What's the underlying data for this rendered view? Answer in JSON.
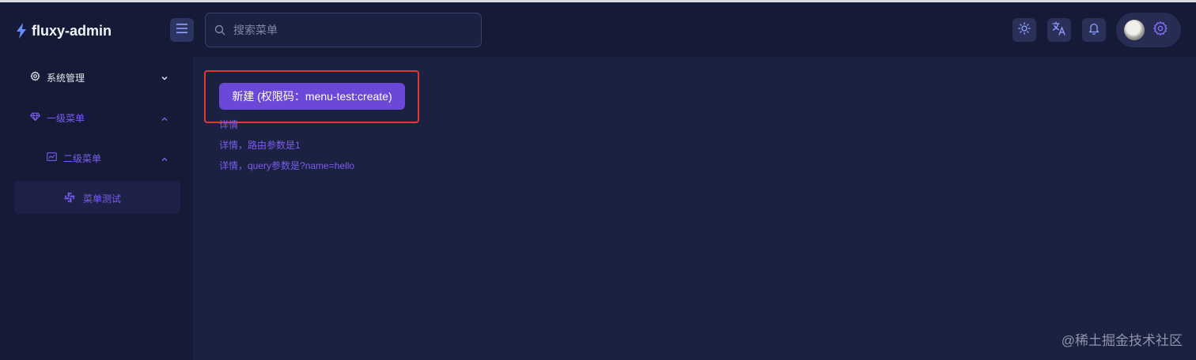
{
  "app": {
    "title": "fluxy-admin"
  },
  "colors": {
    "accent": "#6b48d7",
    "link": "#7b5cf0",
    "background": "#151b36",
    "content_background": "#1b2140",
    "highlight_border": "#e2392f"
  },
  "header": {
    "menu_toggle_icon": "menu-icon",
    "search": {
      "placeholder": "搜索菜单",
      "value": ""
    },
    "actions": [
      {
        "name": "theme-toggle-button",
        "icon": "sun-icon"
      },
      {
        "name": "language-button",
        "icon": "translate-icon"
      },
      {
        "name": "notifications-button",
        "icon": "bell-icon"
      }
    ],
    "settings_icon": "gear-icon"
  },
  "sidebar": {
    "items": [
      {
        "label": "系统管理",
        "icon": "gear-icon",
        "expanded": false
      },
      {
        "label": "一级菜单",
        "icon": "gem-icon",
        "expanded": true
      },
      {
        "label": "二级菜单",
        "icon": "chart-icon",
        "expanded": true
      },
      {
        "label": "菜单测试",
        "icon": "slack-icon",
        "active": true
      }
    ]
  },
  "main": {
    "create_button_label": "新建 (权限码：menu-test:create)",
    "links": [
      "详情",
      "详情，路由参数是1",
      "详情，query参数是?name=hello"
    ]
  },
  "watermark": "@稀土掘金技术社区"
}
